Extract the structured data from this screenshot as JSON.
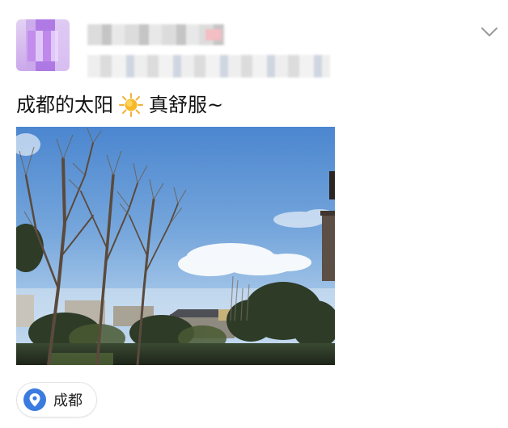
{
  "post": {
    "author_name": "",
    "meta": "",
    "content_before_emoji": "成都的太阳",
    "emoji_icon": "sun-icon",
    "content_after_emoji": "真舒服~",
    "menu_icon": "chevron-down-icon",
    "photo_icon": "photo",
    "location": {
      "icon": "location-pin-icon",
      "label": "成都",
      "color": "#3b7be0"
    }
  }
}
